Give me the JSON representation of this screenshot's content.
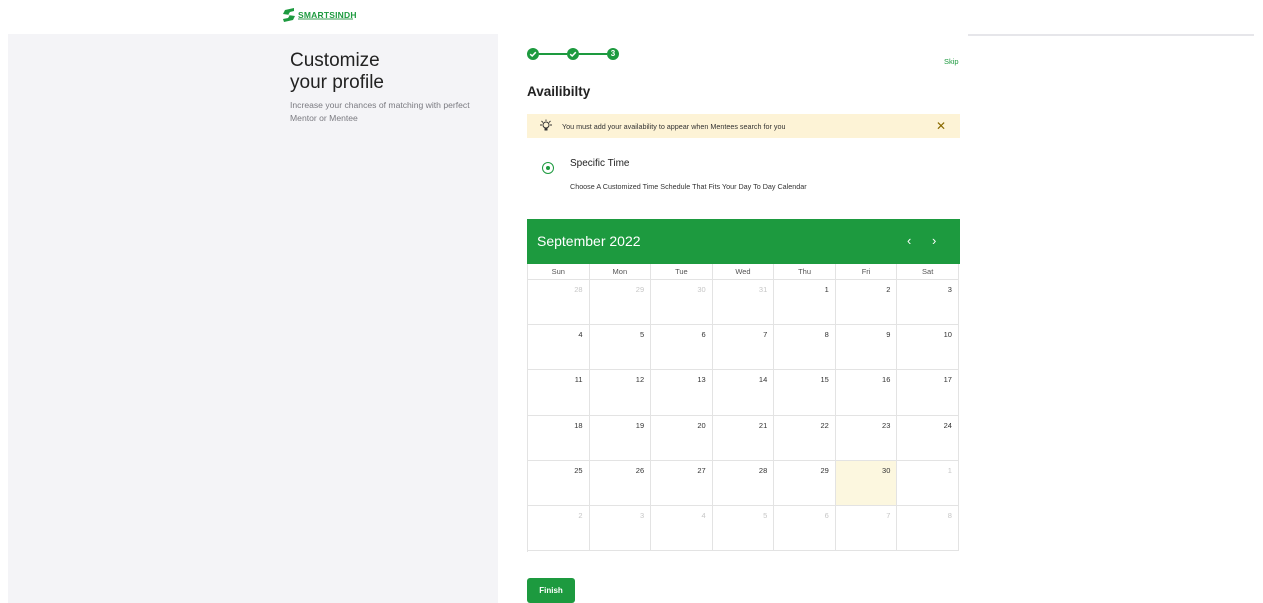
{
  "brand": {
    "name": "SMARTSINDH",
    "color": "#1d9a3f"
  },
  "profile": {
    "heading_line1": "Customize",
    "heading_line2": "your profile",
    "subtext": "Increase your chances of matching with perfect Mentor or Mentee"
  },
  "stepper": {
    "current_step": "3",
    "total_steps": 3
  },
  "skip_label": "Skip",
  "section_title": "Availibilty",
  "alert": {
    "icon": "lightbulb-icon",
    "text": "You must add your availability to appear when Mentees search for you",
    "close_symbol": "✕",
    "background": "#fdf3d6"
  },
  "option": {
    "label": "Specific Time",
    "description": "Choose A Customized Time Schedule That Fits Your Day To Day Calendar",
    "selected": true
  },
  "calendar": {
    "month_label": "September 2022",
    "prev_symbol": "‹",
    "next_symbol": "›",
    "header_color": "#1d9a3f",
    "highlight_color": "#fcf7df",
    "days_of_week": [
      "Sun",
      "Mon",
      "Tue",
      "Wed",
      "Thu",
      "Fri",
      "Sat"
    ],
    "weeks": [
      [
        {
          "d": "28",
          "other": true
        },
        {
          "d": "29",
          "other": true
        },
        {
          "d": "30",
          "other": true
        },
        {
          "d": "31",
          "other": true
        },
        {
          "d": "1"
        },
        {
          "d": "2"
        },
        {
          "d": "3"
        }
      ],
      [
        {
          "d": "4"
        },
        {
          "d": "5"
        },
        {
          "d": "6"
        },
        {
          "d": "7"
        },
        {
          "d": "8"
        },
        {
          "d": "9"
        },
        {
          "d": "10"
        }
      ],
      [
        {
          "d": "11"
        },
        {
          "d": "12"
        },
        {
          "d": "13"
        },
        {
          "d": "14"
        },
        {
          "d": "15"
        },
        {
          "d": "16"
        },
        {
          "d": "17"
        }
      ],
      [
        {
          "d": "18"
        },
        {
          "d": "19"
        },
        {
          "d": "20"
        },
        {
          "d": "21"
        },
        {
          "d": "22"
        },
        {
          "d": "23"
        },
        {
          "d": "24"
        }
      ],
      [
        {
          "d": "25"
        },
        {
          "d": "26"
        },
        {
          "d": "27"
        },
        {
          "d": "28"
        },
        {
          "d": "29"
        },
        {
          "d": "30",
          "today": true
        },
        {
          "d": "1",
          "other": true
        }
      ],
      [
        {
          "d": "2",
          "other": true
        },
        {
          "d": "3",
          "other": true
        },
        {
          "d": "4",
          "other": true
        },
        {
          "d": "5",
          "other": true
        },
        {
          "d": "6",
          "other": true
        },
        {
          "d": "7",
          "other": true
        },
        {
          "d": "8",
          "other": true
        }
      ]
    ]
  },
  "finish_label": "Finish"
}
